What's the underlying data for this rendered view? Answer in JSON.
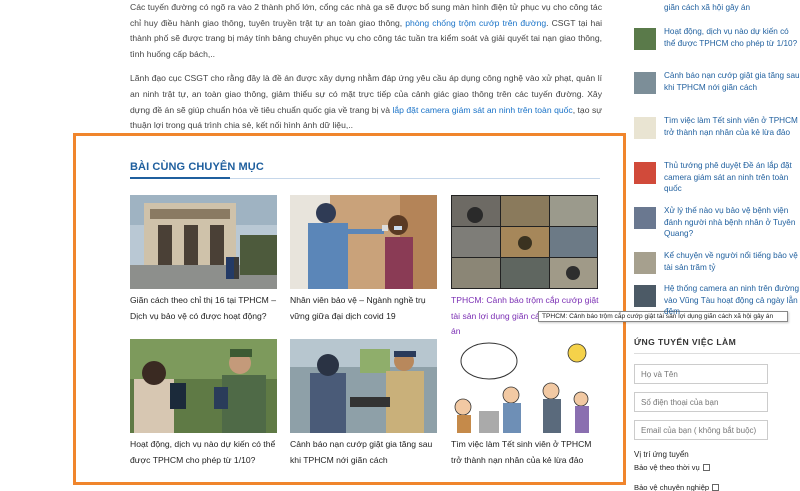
{
  "article": {
    "para1_a": "Các tuyến đường có ngõ ra vào 2 thành phố lớn, cổng các nhà ga sẽ được bổ sung màn hình điện tử phục vụ cho công tác chỉ huy điều hành giao thông, tuyên truyền trật tự an toàn giao thông,",
    "para1_link": "phòng chống trộm cướp trên đường",
    "para1_b": ". CSGT tại hai thành phố sẽ được trang bị máy tính bảng chuyên phục vụ cho công tác tuần tra kiểm soát và giải quyết tai nạn giao thông, tình huống cấp bách,..",
    "para2_a": "Lãnh đạo cục CSGT cho rằng đây là đề án được xây dựng nhằm đáp ứng yêu cầu áp dụng công nghệ vào xử phạt, quản lí an ninh trật tự, an toàn giao thông, giảm thiểu sự có mặt trực tiếp của cảnh giác giao thông trên các tuyến đường. Xây dựng đề án sẽ giúp chuẩn hóa về tiêu chuẩn quốc gia về trang bị và",
    "para2_link": "lắp đặt camera giám sát an ninh trên toàn quốc",
    "para2_b": ", tạo sự thuận lợi trong quá trình chia sẻ, kết nối hình ảnh dữ liệu,.."
  },
  "related": {
    "title": "BÀI CÙNG CHUYÊN MỤC",
    "items": [
      {
        "caption": "Giãn cách theo chỉ thị 16 tại TPHCM – Dịch vụ bảo vệ có được hoạt động?"
      },
      {
        "caption": "Nhân viên bảo vệ – Ngành nghề trụ vững giữa đại dịch covid 19"
      },
      {
        "caption": "TPHCM: Cảnh báo trộm cắp cướp giật tài sản lợi dụng giãn cách xã hội gây án"
      },
      {
        "caption": "Hoạt động, dịch vụ nào dự kiến có thể được TPHCM cho phép từ 1/10?"
      },
      {
        "caption": "Cảnh báo nạn cướp giật gia tăng sau khi TPHCM nới giãn cách"
      },
      {
        "caption": "Tìm việc làm Tết sinh viên ở TPHCM trở thành nạn nhân của kẻ lừa đảo"
      }
    ]
  },
  "tooltip": "TPHCM: Cảnh báo trộm cắp cướp giật tài sản lợi dụng giãn cách xã hội gây án",
  "sidebar": {
    "items": [
      {
        "title": "giãn cách xã hội gây án"
      },
      {
        "title": "Hoạt động, dịch vụ nào dự kiến có thể được TPHCM cho phép từ 1/10?"
      },
      {
        "title": "Cảnh báo nạn cướp giật gia tăng sau khi TPHCM nới giãn cách"
      },
      {
        "title": "Tìm việc làm Tết sinh viên ở TPHCM trở thành nạn nhân của kẻ lừa đảo"
      },
      {
        "title": "Thủ tướng phê duyệt Đề án lắp đặt camera giám sát an ninh trên toàn quốc"
      },
      {
        "title": "Xử lý thế nào vụ bảo vệ bệnh viện đánh người nhà bệnh nhân ở Tuyên Quang?"
      },
      {
        "title": "Kể chuyện về người nổi tiếng bảo vệ tài sản trăm tỷ"
      },
      {
        "title": "Hệ thống camera an ninh trên đường vào Vũng Tàu hoạt động cả ngày lẫn đêm"
      }
    ],
    "form_title": "ỨNG TUYỂN VIỆC LÀM",
    "name_placeholder": "Họ và Tên",
    "phone_placeholder": "Số điện thoại của bạn",
    "email_placeholder": "Email của bạn ( không bắt buộc)",
    "position_label": "Vị trí ứng tuyển",
    "options": [
      "Bảo vệ theo thời vụ",
      "Bảo vệ chuyên nghiệp"
    ]
  }
}
